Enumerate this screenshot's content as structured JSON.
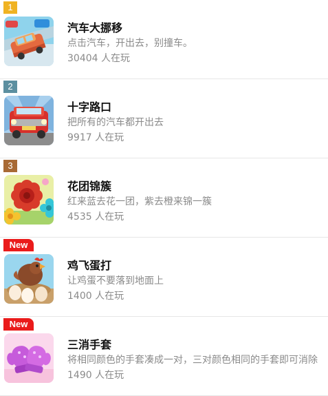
{
  "games": [
    {
      "rank_label": "1",
      "badge_color": "#f0b323",
      "title": "汽车大挪移",
      "desc": "点击汽车，开出去，别撞车。",
      "players": "30404 人在玩",
      "icon": "car-traffic-icon"
    },
    {
      "rank_label": "2",
      "badge_color": "#5c8fa0",
      "title": "十字路口",
      "desc": "把所有的汽车都开出去",
      "players": "9917 人在玩",
      "icon": "red-truck-icon"
    },
    {
      "rank_label": "3",
      "badge_color": "#a86a35",
      "title": "花团锦簇",
      "desc": "红来蓝去花一团，紫去橙来锦一簇",
      "players": "4535 人在玩",
      "icon": "flowers-icon"
    },
    {
      "rank_label": "New",
      "badge_color": "#ea1b1b",
      "title": "鸡飞蛋打",
      "desc": "让鸡蛋不要落到地面上",
      "players": "1400 人在玩",
      "icon": "chicken-eggs-icon"
    },
    {
      "rank_label": "New",
      "badge_color": "#ea1b1b",
      "title": "三消手套",
      "desc": "将相同颜色的手套凑成一对，三对颜色相同的手套即可消除",
      "players": "1490 人在玩",
      "icon": "mittens-icon"
    }
  ]
}
